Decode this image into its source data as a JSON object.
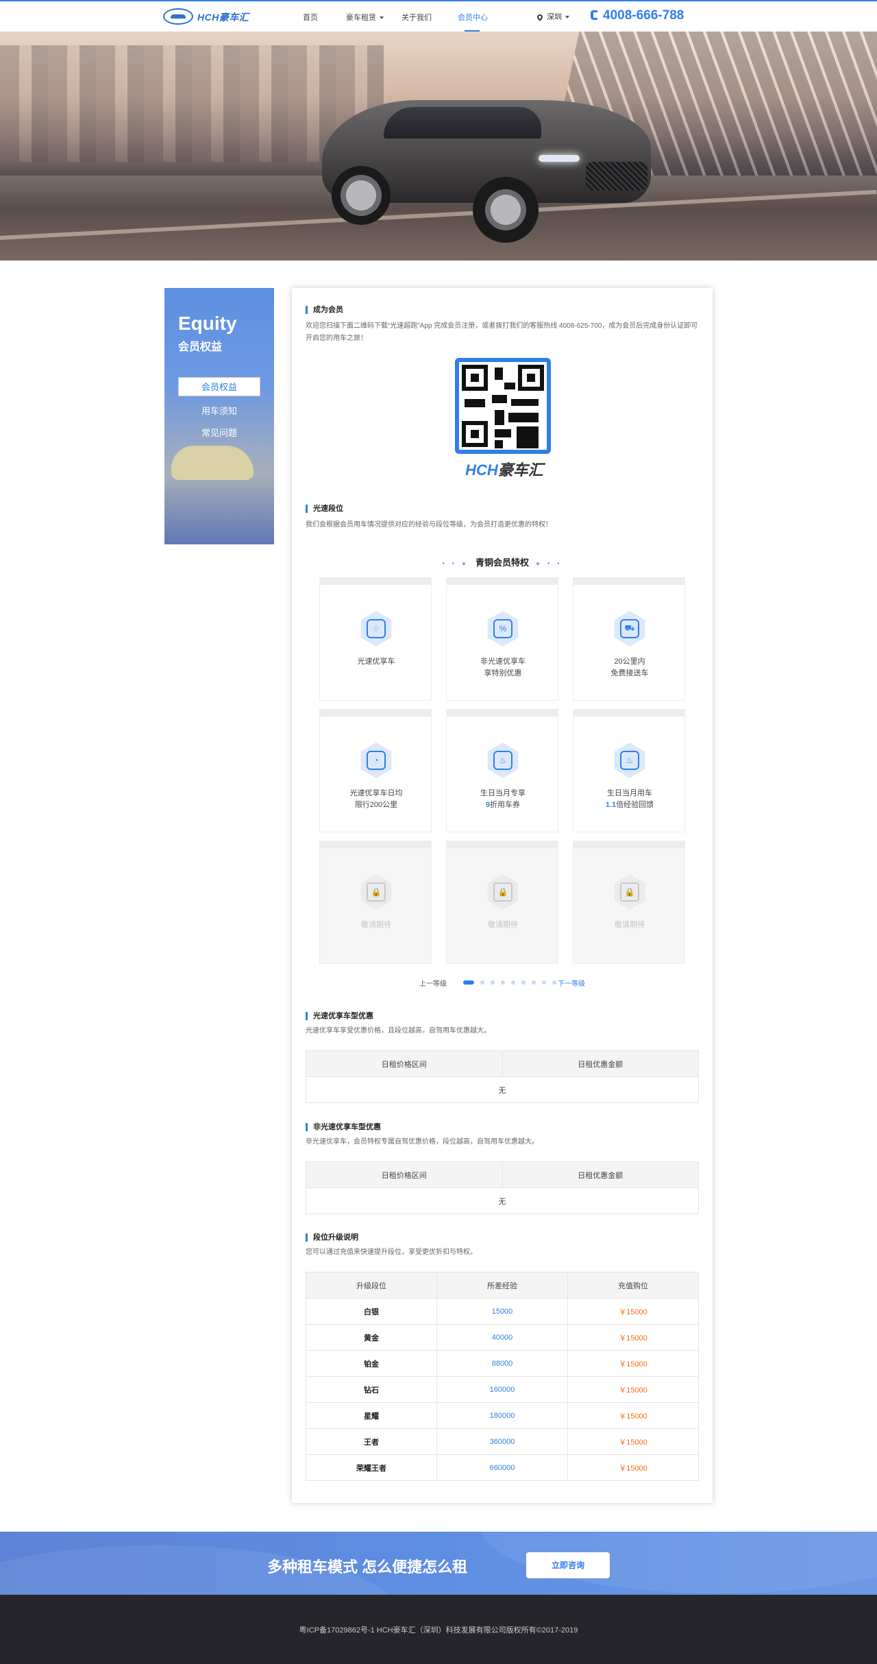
{
  "header": {
    "logo_text": "HCH豪车汇",
    "nav": [
      {
        "label": "首页"
      },
      {
        "label": "豪车租赁"
      },
      {
        "label": "关于我们"
      },
      {
        "label": "会员中心"
      }
    ],
    "city": "深圳",
    "phone": "4008-666-788"
  },
  "sidebar": {
    "title_en": "Equity",
    "title_cn": "会员权益",
    "items": [
      {
        "label": "会员权益"
      },
      {
        "label": "用车须知"
      },
      {
        "label": "常见问题"
      }
    ]
  },
  "become_member": {
    "title": "成为会员",
    "desc": "欢迎您扫描下面二维码下载“光速超跑”App 完成会员注册，或者拨打我们的客服热线 4008-625-700，成为会员后完成身份认证即可开启您的用车之旅！",
    "brand_a": "HCH",
    "brand_b": "豪车汇"
  },
  "speed_rank": {
    "title": "光速段位",
    "desc": "我们会根据会员用车情况提供对应的经验与段位等级，为会员打造更优惠的特权！"
  },
  "tier": {
    "dots_left": "• • ●",
    "title": "青铜会员特权",
    "dots_right": "● • •"
  },
  "privileges": [
    {
      "icon": "diamond-icon",
      "glyph": "♢",
      "line1": "光速优享车",
      "line2": "",
      "highlight": ""
    },
    {
      "icon": "discount-icon",
      "glyph": "%",
      "line1": "非光速优享车",
      "line2": "享特别优惠",
      "highlight": ""
    },
    {
      "icon": "delivery-icon",
      "glyph": "⛟",
      "line1": "20公里内",
      "line2": "免费接送车",
      "highlight": ""
    },
    {
      "icon": "speedometer-icon",
      "glyph": "◔",
      "line1": "光速优享车日均",
      "line2": "限行200公里",
      "highlight": ""
    },
    {
      "icon": "birthday-cake-icon",
      "glyph": "♨",
      "line1": "生日当月专享",
      "line2": "折用车券",
      "highlight": "9"
    },
    {
      "icon": "birthday-bonus-icon",
      "glyph": "♨",
      "line1": "生日当月用车",
      "line2": "倍经验回馈",
      "highlight": "1.1"
    },
    {
      "icon": "lock-icon",
      "glyph": "🔒",
      "line1": "敬请期待",
      "line2": "",
      "highlight": ""
    },
    {
      "icon": "lock-icon",
      "glyph": "🔒",
      "line1": "敬请期待",
      "line2": "",
      "highlight": ""
    },
    {
      "icon": "lock-icon",
      "glyph": "🔒",
      "line1": "敬请期待",
      "line2": "",
      "highlight": ""
    }
  ],
  "pager": {
    "prev": "上一等级",
    "next": "下一等级",
    "total_dots": 9,
    "active_index": 0
  },
  "preferred": {
    "title": "光速优享车型优惠",
    "desc": "光速优享车享受优惠价格，且段位越高，自驾用车优惠越大。",
    "headers": [
      "日租价格区间",
      "日租优惠金额"
    ],
    "empty": "无"
  },
  "non_preferred": {
    "title": "非光速优享车型优惠",
    "desc": "非光速优享车，会员特权专属自驾优惠价格，段位越高，自驾用车优惠越大。",
    "headers": [
      "日租价格区间",
      "日租优惠金额"
    ],
    "empty": "无"
  },
  "upgrade": {
    "title": "段位升级说明",
    "desc": "您可以通过充值来快速提升段位，享受更优折扣与特权。",
    "headers": [
      "升级段位",
      "所差经验",
      "充值购位"
    ],
    "rows": [
      {
        "level": "白银",
        "exp": "15000",
        "price": "￥15000"
      },
      {
        "level": "黄金",
        "exp": "40000",
        "price": "￥15000"
      },
      {
        "level": "铂金",
        "exp": "88000",
        "price": "￥15000"
      },
      {
        "level": "钻石",
        "exp": "160000",
        "price": "￥15000"
      },
      {
        "level": "星耀",
        "exp": "180000",
        "price": "￥15000"
      },
      {
        "level": "王者",
        "exp": "360000",
        "price": "￥15000"
      },
      {
        "level": "荣耀王者",
        "exp": "660000",
        "price": "￥15000"
      }
    ]
  },
  "cta": {
    "slogan": "多种租车模式  怎么便捷怎么租",
    "button": "立即咨询"
  },
  "footer": {
    "copyright": "粤ICP备17029862号-1 HCH豪车汇（深圳）科技发展有限公司版权所有©2017-2019"
  }
}
